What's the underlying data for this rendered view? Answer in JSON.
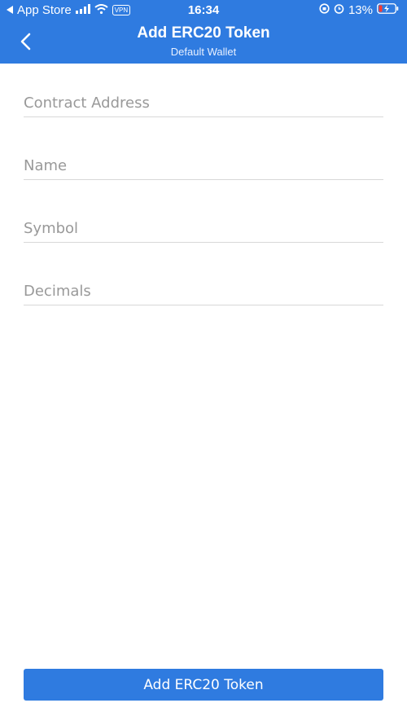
{
  "status_bar": {
    "back_app": "App Store",
    "vpn": "VPN",
    "time": "16:34",
    "battery": "13%"
  },
  "header": {
    "title": "Add ERC20 Token",
    "subtitle": "Default Wallet"
  },
  "form": {
    "fields": [
      {
        "placeholder": "Contract Address",
        "value": ""
      },
      {
        "placeholder": "Name",
        "value": ""
      },
      {
        "placeholder": "Symbol",
        "value": ""
      },
      {
        "placeholder": "Decimals",
        "value": ""
      }
    ]
  },
  "submit": {
    "label": "Add ERC20 Token"
  },
  "colors": {
    "accent": "#2f7be0",
    "divider": "#d8d8d8",
    "placeholder": "#999999"
  }
}
